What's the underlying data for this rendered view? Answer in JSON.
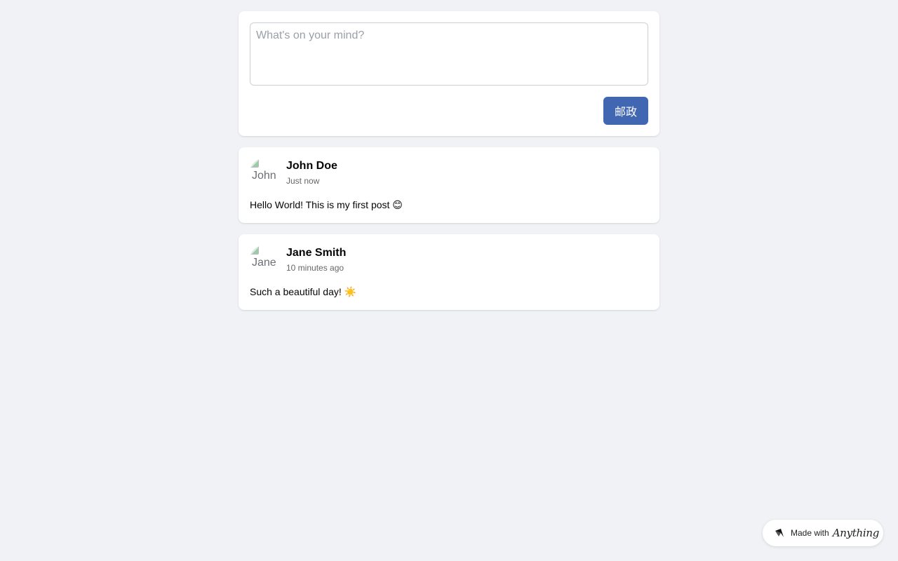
{
  "composer": {
    "placeholder": "What's on your mind?",
    "value": "",
    "post_label": "邮政",
    "post_button_color": "#4267b2"
  },
  "posts": [
    {
      "author": "John Doe",
      "avatar_alt": "John Doe",
      "time": "Just now",
      "content": "Hello World! This is my first post 😊"
    },
    {
      "author": "Jane Smith",
      "avatar_alt": "Jane Smith",
      "time": "10 minutes ago",
      "content": "Such a beautiful day! ☀️"
    }
  ],
  "badge": {
    "prefix": "Made with",
    "brand": "Anything",
    "icon": "anything-logo-icon"
  }
}
